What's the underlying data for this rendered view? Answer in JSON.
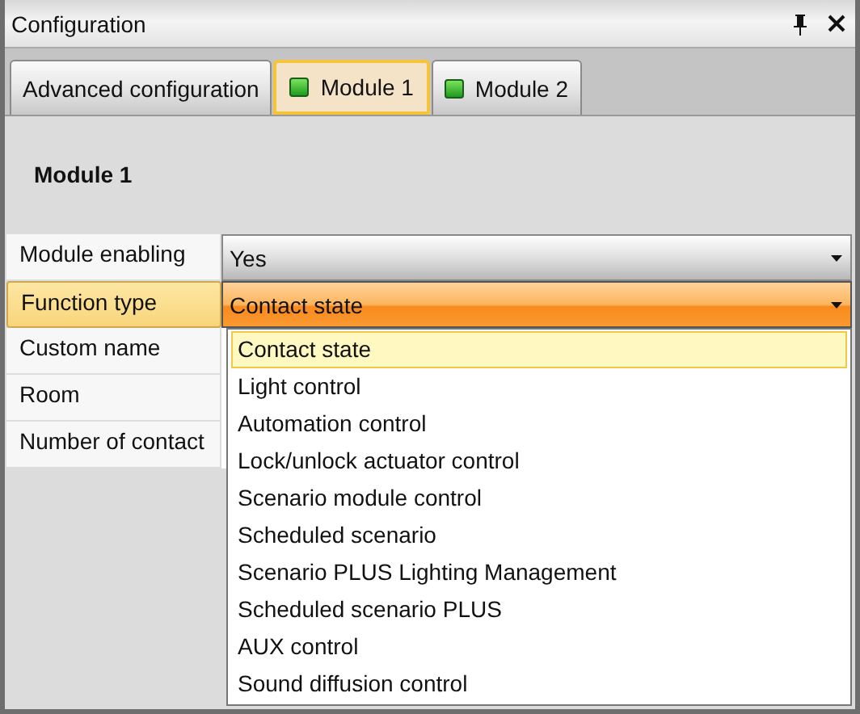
{
  "window": {
    "title": "Configuration"
  },
  "tabs": [
    {
      "label": "Advanced configuration",
      "kind": "plain",
      "selected": false
    },
    {
      "label": "Module 1",
      "kind": "module",
      "selected": true
    },
    {
      "label": "Module 2",
      "kind": "module",
      "selected": false
    }
  ],
  "section_title": "Module 1",
  "properties": [
    {
      "label": "Module enabling",
      "value": "Yes",
      "selected": false
    },
    {
      "label": "Function type",
      "value": "Contact state",
      "selected": true
    },
    {
      "label": "Custom name",
      "selected": false
    },
    {
      "label": "Room",
      "selected": false
    },
    {
      "label": "Number of contact",
      "selected": false
    }
  ],
  "dropdown": {
    "items": [
      {
        "label": "Contact state",
        "selected": true
      },
      {
        "label": "Light control",
        "selected": false
      },
      {
        "label": "Automation control",
        "selected": false
      },
      {
        "label": "Lock/unlock actuator control",
        "selected": false
      },
      {
        "label": "Scenario module control",
        "selected": false
      },
      {
        "label": "Scheduled scenario",
        "selected": false
      },
      {
        "label": "Scenario PLUS Lighting Management",
        "selected": false
      },
      {
        "label": "Scheduled scenario PLUS",
        "selected": false
      },
      {
        "label": "AUX control",
        "selected": false
      },
      {
        "label": "Sound diffusion control",
        "selected": false
      }
    ]
  }
}
